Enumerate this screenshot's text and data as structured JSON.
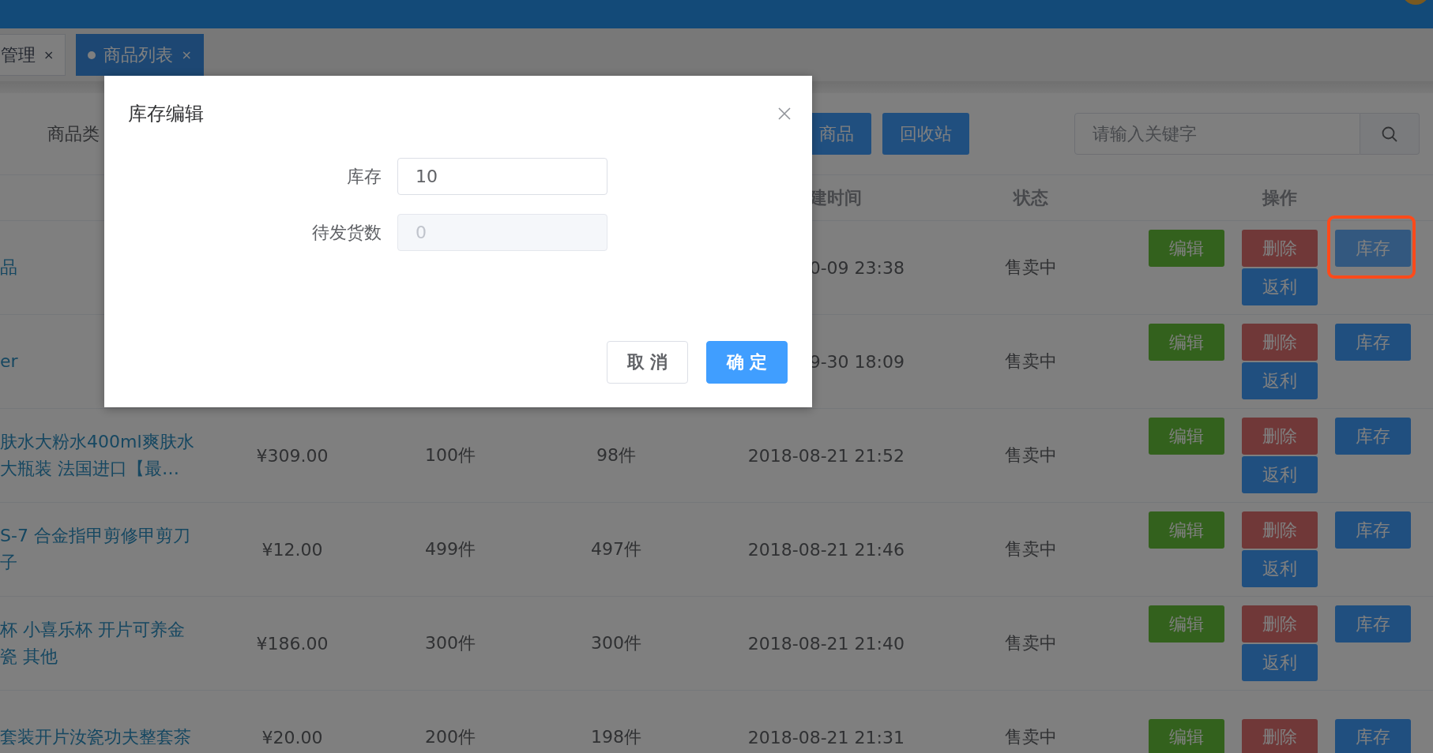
{
  "tabs": [
    {
      "label": "管理",
      "close": "×",
      "selected": false
    },
    {
      "label": "商品列表",
      "close": "×",
      "selected": true
    }
  ],
  "toolbar": {
    "filter_label": "商品类",
    "buttons": [
      "商品",
      "回收站"
    ],
    "search": {
      "placeholder": "请输入关键字"
    }
  },
  "table": {
    "header": {
      "time": "建时间",
      "status": "状态",
      "actions": "操作"
    },
    "rows": [
      {
        "name": [
          "品"
        ],
        "time": "0-09 23:38",
        "status": "售卖中",
        "actions": [
          {
            "label": "编辑",
            "kind": "edit",
            "disabled": false,
            "highlighted": false
          },
          {
            "label": "删除",
            "kind": "delete",
            "disabled": true,
            "highlighted": false
          },
          {
            "label": "库存",
            "kind": "stock",
            "disabled": false,
            "highlighted": true
          },
          {
            "label": "返利",
            "kind": "rebate",
            "disabled": false,
            "highlighted": false
          }
        ]
      },
      {
        "name": [
          "er"
        ],
        "time": "9-30 18:09",
        "status": "售卖中",
        "actions": [
          {
            "label": "编辑",
            "kind": "edit",
            "disabled": false,
            "highlighted": false
          },
          {
            "label": "删除",
            "kind": "delete",
            "disabled": true,
            "highlighted": false
          },
          {
            "label": "库存",
            "kind": "stock",
            "disabled": false,
            "highlighted": false
          },
          {
            "label": "返利",
            "kind": "rebate",
            "disabled": false,
            "highlighted": false
          }
        ]
      },
      {
        "name": [
          "肤水大粉水400ml爽肤水",
          "大瓶装 法国进口【最…"
        ],
        "price": "¥309.00",
        "stock": "100件",
        "pending": "98件",
        "time": "2018-08-21 21:52",
        "status": "售卖中",
        "actions": [
          {
            "label": "编辑",
            "kind": "edit",
            "disabled": false,
            "highlighted": false
          },
          {
            "label": "删除",
            "kind": "delete",
            "disabled": true,
            "highlighted": false
          },
          {
            "label": "库存",
            "kind": "stock",
            "disabled": false,
            "highlighted": false
          },
          {
            "label": "返利",
            "kind": "rebate",
            "disabled": false,
            "highlighted": false
          }
        ]
      },
      {
        "name": [
          "S-7 合金指甲剪修甲剪刀",
          "子"
        ],
        "price": "¥12.00",
        "stock": "499件",
        "pending": "497件",
        "time": "2018-08-21 21:46",
        "status": "售卖中",
        "actions": [
          {
            "label": "编辑",
            "kind": "edit",
            "disabled": false,
            "highlighted": false
          },
          {
            "label": "删除",
            "kind": "delete",
            "disabled": true,
            "highlighted": false
          },
          {
            "label": "库存",
            "kind": "stock",
            "disabled": false,
            "highlighted": false
          },
          {
            "label": "返利",
            "kind": "rebate",
            "disabled": false,
            "highlighted": false
          }
        ]
      },
      {
        "name": [
          "杯 小喜乐杯 开片可养金",
          "瓷 其他"
        ],
        "price": "¥186.00",
        "stock": "300件",
        "pending": "300件",
        "time": "2018-08-21 21:40",
        "status": "售卖中",
        "actions": [
          {
            "label": "编辑",
            "kind": "edit",
            "disabled": false,
            "highlighted": false
          },
          {
            "label": "删除",
            "kind": "delete",
            "disabled": true,
            "highlighted": false
          },
          {
            "label": "库存",
            "kind": "stock",
            "disabled": false,
            "highlighted": false
          },
          {
            "label": "返利",
            "kind": "rebate",
            "disabled": false,
            "highlighted": false
          }
        ]
      },
      {
        "name": [
          "套装开片汝瓷功夫整套茶"
        ],
        "price": "¥20.00",
        "stock": "200件",
        "pending": "198件",
        "time": "2018-08-21 21:31",
        "status": "售卖中",
        "actions": [
          {
            "label": "编辑",
            "kind": "edit",
            "disabled": false,
            "highlighted": false
          },
          {
            "label": "删除",
            "kind": "delete",
            "disabled": true,
            "highlighted": false
          },
          {
            "label": "库存",
            "kind": "stock",
            "disabled": false,
            "highlighted": false
          }
        ]
      }
    ]
  },
  "dialog": {
    "title": "库存编辑",
    "fields": [
      {
        "label": "库存",
        "value": "10",
        "disabled": false
      },
      {
        "label": "待发货数",
        "value": "0",
        "disabled": true
      }
    ],
    "buttons": [
      {
        "label": "取 消",
        "kind": "default"
      },
      {
        "label": "确 定",
        "kind": "primary"
      }
    ]
  }
}
